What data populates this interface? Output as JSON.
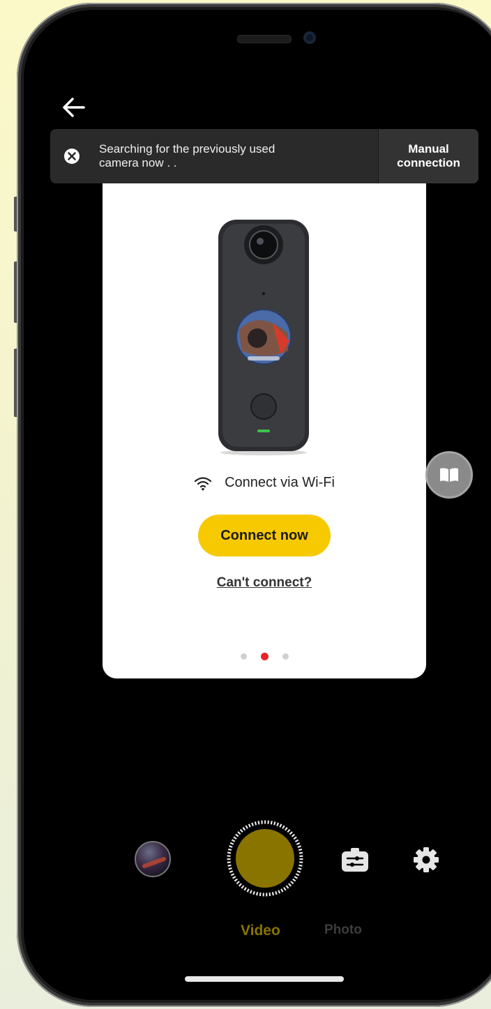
{
  "banner": {
    "message": "Searching for the previously used camera now . .",
    "manual_line1": "Manual",
    "manual_line2": "connection"
  },
  "card": {
    "wifi_label": "Connect via Wi-Fi",
    "connect_button": "Connect now",
    "cant_connect": "Can't connect?",
    "pager": {
      "count": 3,
      "active_index": 1
    }
  },
  "bottom": {
    "tabs": {
      "video": "Video",
      "photo": "Photo"
    },
    "active_tab": "video"
  },
  "colors": {
    "accent": "#f7c900",
    "shutter": "#8a7400",
    "active_dot": "#e8232a",
    "banner_bg": "#2a2a2a"
  },
  "icons": {
    "back": "arrow-left-icon",
    "close": "close-circle-icon",
    "wifi": "wifi-icon",
    "guide": "book-icon",
    "mode": "sliders-icon",
    "settings": "gear-icon"
  }
}
